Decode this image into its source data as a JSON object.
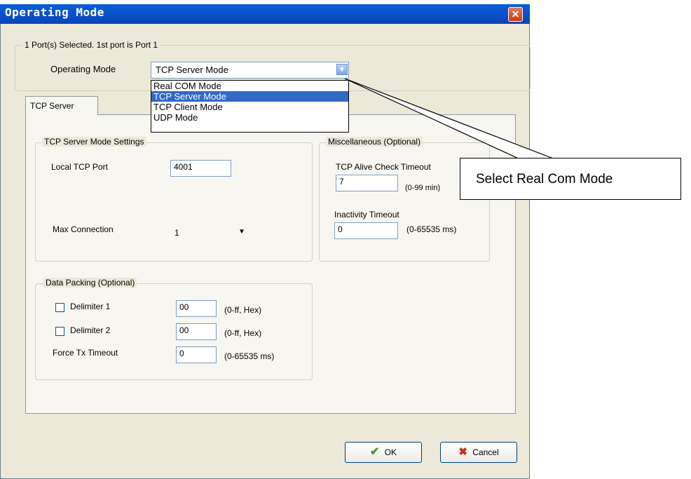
{
  "window": {
    "title": "Operating Mode",
    "close_glyph": "✕"
  },
  "port_group": {
    "label": "1 Port(s) Selected. 1st port is Port 1",
    "mode_label": "Operating Mode",
    "mode_value": "TCP Server Mode",
    "dropdown_options": [
      {
        "label": "Real COM Mode",
        "selected": false
      },
      {
        "label": "TCP Server Mode",
        "selected": true
      },
      {
        "label": "TCP Client Mode",
        "selected": false
      },
      {
        "label": "UDP Mode",
        "selected": false
      }
    ]
  },
  "tabs": [
    {
      "label": "TCP Server",
      "active": true
    }
  ],
  "server_settings": {
    "label": "TCP Server Mode Settings",
    "local_port_label": "Local TCP Port",
    "local_port_value": "4001",
    "max_conn_label": "Max Connection",
    "max_conn_value": "1"
  },
  "misc": {
    "label": "Miscellaneous (Optional)",
    "alive_label": "TCP Alive Check Timeout",
    "alive_value": "7",
    "alive_range": "(0-99 min)",
    "inactivity_label": "Inactivity Timeout",
    "inactivity_value": "0",
    "inactivity_range": "(0-65535 ms)"
  },
  "packing": {
    "label": "Data Packing (Optional)",
    "delimiter1_label": "Delimiter 1",
    "delimiter1_checked": false,
    "delimiter1_value": "00",
    "delimiter1_range": "(0-ff, Hex)",
    "delimiter2_label": "Delimiter 2",
    "delimiter2_checked": false,
    "delimiter2_value": "00",
    "delimiter2_range": "(0-ff, Hex)",
    "force_label": "Force Tx Timeout",
    "force_value": "0",
    "force_range": "(0-65535 ms)"
  },
  "buttons": {
    "ok": "OK",
    "cancel": "Cancel"
  },
  "callout": {
    "text": "Select Real Com Mode"
  },
  "colors": {
    "titlebar": "#0a4fc7",
    "dialog_bg": "#ece9d8",
    "selection": "#316ac5",
    "ok_icon": "#3a9a2a",
    "cancel_icon": "#cc2a1a"
  },
  "icons": {
    "close": "close-icon",
    "dropdown": "chevron-down-icon",
    "ok": "checkmark-icon",
    "cancel": "x-icon"
  }
}
